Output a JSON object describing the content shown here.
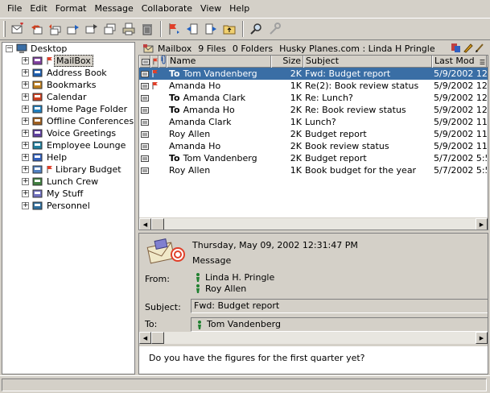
{
  "menu": [
    "File",
    "Edit",
    "Format",
    "Message",
    "Collaborate",
    "View",
    "Help"
  ],
  "toolbar": {
    "buttons": [
      "new-mail-icon",
      "reply-icon",
      "reply-all-icon",
      "forward-icon",
      "move-icon",
      "copy-icon",
      "print-icon",
      "delete-icon",
      "flag-icon",
      "prev-icon",
      "next-icon",
      "folder-up-icon",
      "find-icon",
      "tools-icon"
    ]
  },
  "tree": {
    "root": "Desktop",
    "items": [
      {
        "label": "MailBox",
        "icon": "mailbox-icon",
        "flag": true,
        "selected": true
      },
      {
        "label": "Address Book",
        "icon": "address-book-icon"
      },
      {
        "label": "Bookmarks",
        "icon": "bookmarks-icon"
      },
      {
        "label": "Calendar",
        "icon": "calendar-icon"
      },
      {
        "label": "Home Page Folder",
        "icon": "home-page-icon"
      },
      {
        "label": "Offline Conferences",
        "icon": "conference-icon"
      },
      {
        "label": "Voice Greetings",
        "icon": "voice-icon"
      },
      {
        "label": "Employee Lounge",
        "icon": "lounge-icon"
      },
      {
        "label": "Help",
        "icon": "help-icon"
      },
      {
        "label": "Library Budget",
        "icon": "group-icon",
        "flag": true
      },
      {
        "label": "Lunch Crew",
        "icon": "lunch-icon"
      },
      {
        "label": "My Stuff",
        "icon": "my-stuff-icon"
      },
      {
        "label": "Personnel",
        "icon": "personnel-icon"
      }
    ]
  },
  "path": {
    "folder": "Mailbox",
    "files": "9 Files",
    "folders": "0 Folders",
    "location": "Husky Planes.com : Linda H Pringle"
  },
  "columns": {
    "name": "Name",
    "size": "Size",
    "subject": "Subject",
    "date": "Last Mod"
  },
  "messages": [
    {
      "to": "To",
      "name": "Tom Vandenberg",
      "size": "2K",
      "subject": "Fwd: Budget report",
      "date": "5/9/2002 12",
      "flag": true,
      "selected": true
    },
    {
      "to": "",
      "name": "Amanda Ho",
      "size": "1K",
      "subject": "Re(2): Book review status",
      "date": "5/9/2002 12",
      "flag": true
    },
    {
      "to": "To",
      "name": "Amanda Clark",
      "size": "1K",
      "subject": "Re: Lunch?",
      "date": "5/9/2002 12"
    },
    {
      "to": "To",
      "name": "Amanda Ho",
      "size": "2K",
      "subject": "Re: Book review status",
      "date": "5/9/2002 12"
    },
    {
      "to": "",
      "name": "Amanda Clark",
      "size": "1K",
      "subject": "Lunch?",
      "date": "5/9/2002 11"
    },
    {
      "to": "",
      "name": "Roy Allen",
      "size": "2K",
      "subject": "Budget report",
      "date": "5/9/2002 11"
    },
    {
      "to": "",
      "name": "Amanda Ho",
      "size": "2K",
      "subject": "Book review status",
      "date": "5/9/2002 11"
    },
    {
      "to": "To",
      "name": "Tom Vandenberg",
      "size": "2K",
      "subject": "Budget report",
      "date": "5/7/2002 5:5"
    },
    {
      "to": "",
      "name": "Roy Allen",
      "size": "1K",
      "subject": "Book budget for the year",
      "date": "5/7/2002 5:5"
    }
  ],
  "preview": {
    "date": "Thursday, May 09, 2002 12:31:47 PM",
    "type": "Message",
    "from_label": "From:",
    "from": [
      "Linda H. Pringle",
      "Roy Allen"
    ],
    "subject_label": "Subject:",
    "subject": "Fwd: Budget report",
    "to_label": "To:",
    "to": "Tom Vandenberg",
    "body": "Do you have the figures for the first quarter yet?"
  },
  "colors": {
    "selection": "#3a6ea5",
    "chrome": "#d4d0c8",
    "flag": "#e0402a"
  }
}
